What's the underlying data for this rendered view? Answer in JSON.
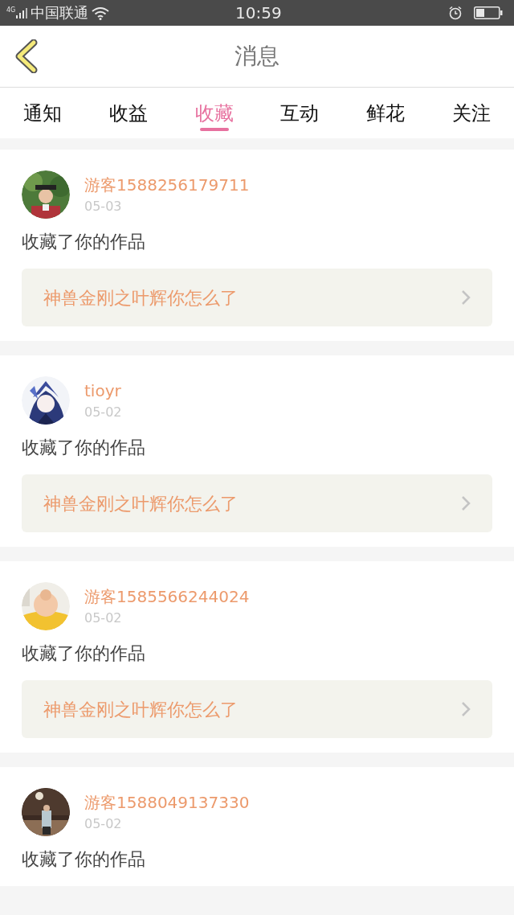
{
  "status_bar": {
    "network": "4G",
    "carrier": "中国联通",
    "time": "10:59"
  },
  "header": {
    "title": "消息"
  },
  "tabs": [
    {
      "label": "通知",
      "selected": false
    },
    {
      "label": "收益",
      "selected": false
    },
    {
      "label": "收藏",
      "selected": true
    },
    {
      "label": "互动",
      "selected": false
    },
    {
      "label": "鲜花",
      "selected": false
    },
    {
      "label": "关注",
      "selected": false
    }
  ],
  "messages": [
    {
      "user": "游客1588256179711",
      "date": "05-03",
      "action": "收藏了你的作品",
      "work": "神兽金刚之叶辉你怎么了"
    },
    {
      "user": "tioyr",
      "date": "05-02",
      "action": "收藏了你的作品",
      "work": "神兽金刚之叶辉你怎么了"
    },
    {
      "user": "游客1585566244024",
      "date": "05-02",
      "action": "收藏了你的作品",
      "work": "神兽金刚之叶辉你怎么了"
    },
    {
      "user": "游客1588049137330",
      "date": "05-02",
      "action": "收藏了你的作品"
    }
  ]
}
